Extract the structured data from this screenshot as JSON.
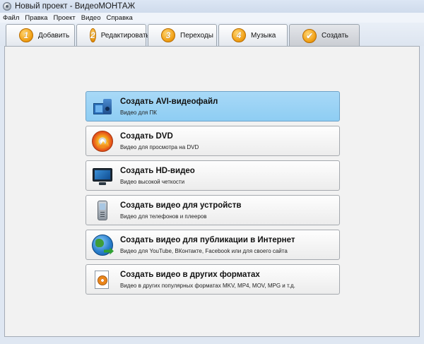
{
  "window": {
    "title": "Новый проект - ВидеоМОНТАЖ"
  },
  "menu": {
    "items": [
      "Файл",
      "Правка",
      "Проект",
      "Видео",
      "Справка"
    ]
  },
  "tabs": [
    {
      "number": "1",
      "label": "Добавить",
      "active": false
    },
    {
      "number": "2",
      "label": "Редактировать",
      "active": false
    },
    {
      "number": "3",
      "label": "Переходы",
      "active": false
    },
    {
      "number": "4",
      "label": "Музыка",
      "active": false
    },
    {
      "number": "",
      "label": "Создать",
      "active": true,
      "icon": "checkmark-icon"
    }
  ],
  "options": [
    {
      "title": "Создать AVI-видеофайл",
      "subtitle": "Видео для ПК",
      "icon": "avi-file-icon",
      "selected": true
    },
    {
      "title": "Создать DVD",
      "subtitle": "Видео для просмотра на DVD",
      "icon": "dvd-disc-icon",
      "selected": false
    },
    {
      "title": "Создать HD-видео",
      "subtitle": "Видео высокой четкости",
      "icon": "hd-monitor-icon",
      "selected": false
    },
    {
      "title": "Создать видео для устройств",
      "subtitle": "Видео для телефонов и плееров",
      "icon": "mobile-phone-icon",
      "selected": false
    },
    {
      "title": "Создать видео для публикации в Интернет",
      "subtitle": "Видео для YouTube, ВКонтакте, Facebook или для своего сайта",
      "icon": "globe-icon",
      "selected": false
    },
    {
      "title": "Создать видео в других форматах",
      "subtitle": "Видео в других популярных форматах MKV, MP4, MOV, MPG и т.д.",
      "icon": "film-reel-document-icon",
      "selected": false
    }
  ],
  "colors": {
    "selected_option_bg": "#8ecdf3",
    "tab_number_bg": "#f2a31a",
    "window_bg": "#dfe7f2"
  }
}
